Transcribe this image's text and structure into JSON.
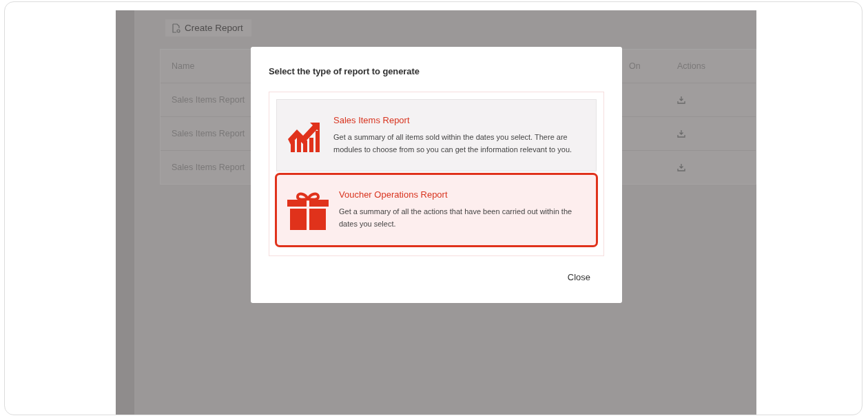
{
  "toolbar": {
    "create_button": "Create Report"
  },
  "table": {
    "columns": [
      "Name",
      "On",
      "Actions"
    ],
    "rows": [
      {
        "name": "Sales Items Report"
      },
      {
        "name": "Sales Items Report"
      },
      {
        "name": "Sales Items Report"
      }
    ]
  },
  "dialog": {
    "title": "Select the type of report to generate",
    "options": [
      {
        "kind": "chart",
        "title": "Sales Items Report",
        "description": "Get a summary of all items sold within the dates you select. There are modules to choose from so you can get the information relevant to you.",
        "selected": false
      },
      {
        "kind": "gift",
        "title": "Voucher Operations Report",
        "description": "Get a summary of all the actions that have been carried out within the dates you select.",
        "selected": true
      }
    ],
    "close_button": "Close"
  }
}
